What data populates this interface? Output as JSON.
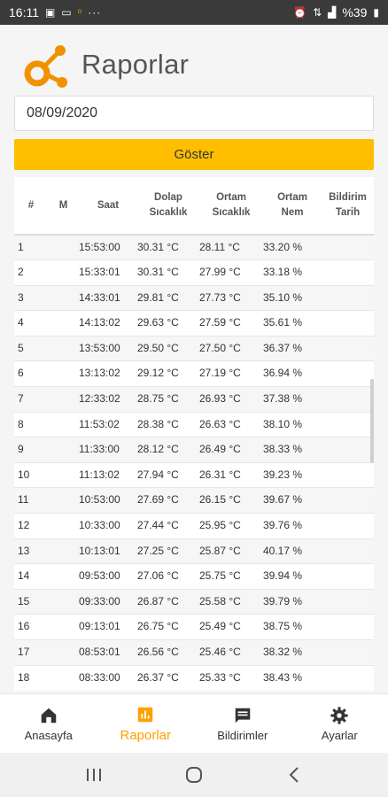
{
  "status_bar": {
    "time": "16:11",
    "battery": "%39"
  },
  "header": {
    "title": "Raporlar"
  },
  "date_input": {
    "value": "08/09/2020"
  },
  "show_button": {
    "label": "Göster"
  },
  "table": {
    "headers": [
      "#",
      "M",
      "Saat",
      "Dolap Sıcaklık",
      "Ortam Sıcaklık",
      "Ortam Nem",
      "Bildirim Tarih"
    ],
    "rows": [
      [
        "1",
        "",
        "15:53:00",
        "30.31 °C",
        "28.11 °C",
        "33.20 %",
        ""
      ],
      [
        "2",
        "",
        "15:33:01",
        "30.31 °C",
        "27.99 °C",
        "33.18 %",
        ""
      ],
      [
        "3",
        "",
        "14:33:01",
        "29.81 °C",
        "27.73 °C",
        "35.10 %",
        ""
      ],
      [
        "4",
        "",
        "14:13:02",
        "29.63 °C",
        "27.59 °C",
        "35.61 %",
        ""
      ],
      [
        "5",
        "",
        "13:53:00",
        "29.50 °C",
        "27.50 °C",
        "36.37 %",
        ""
      ],
      [
        "6",
        "",
        "13:13:02",
        "29.12 °C",
        "27.19 °C",
        "36.94 %",
        ""
      ],
      [
        "7",
        "",
        "12:33:02",
        "28.75 °C",
        "26.93 °C",
        "37.38 %",
        ""
      ],
      [
        "8",
        "",
        "11:53:02",
        "28.38 °C",
        "26.63 °C",
        "38.10 %",
        ""
      ],
      [
        "9",
        "",
        "11:33:00",
        "28.12 °C",
        "26.49 °C",
        "38.33 %",
        ""
      ],
      [
        "10",
        "",
        "11:13:02",
        "27.94 °C",
        "26.31 °C",
        "39.23 %",
        ""
      ],
      [
        "11",
        "",
        "10:53:00",
        "27.69 °C",
        "26.15 °C",
        "39.67 %",
        ""
      ],
      [
        "12",
        "",
        "10:33:00",
        "27.44 °C",
        "25.95 °C",
        "39.76 %",
        ""
      ],
      [
        "13",
        "",
        "10:13:01",
        "27.25 °C",
        "25.87 °C",
        "40.17 %",
        ""
      ],
      [
        "14",
        "",
        "09:53:00",
        "27.06 °C",
        "25.75 °C",
        "39.94 %",
        ""
      ],
      [
        "15",
        "",
        "09:33:00",
        "26.87 °C",
        "25.58 °C",
        "39.79 %",
        ""
      ],
      [
        "16",
        "",
        "09:13:01",
        "26.75 °C",
        "25.49 °C",
        "38.75 %",
        ""
      ],
      [
        "17",
        "",
        "08:53:01",
        "26.56 °C",
        "25.46 °C",
        "38.32 %",
        ""
      ],
      [
        "18",
        "",
        "08:33:00",
        "26.37 °C",
        "25.33 °C",
        "38.43 %",
        ""
      ]
    ]
  },
  "bottom_nav": {
    "items": [
      {
        "label": "Anasayfa",
        "icon": "home-icon"
      },
      {
        "label": "Raporlar",
        "icon": "report-icon",
        "active": true
      },
      {
        "label": "Bildirimler",
        "icon": "message-icon"
      },
      {
        "label": "Ayarlar",
        "icon": "gear-icon"
      }
    ]
  },
  "colors": {
    "accent": "#ffbf00",
    "active_nav": "#ffa000",
    "logo": "#f29100"
  }
}
